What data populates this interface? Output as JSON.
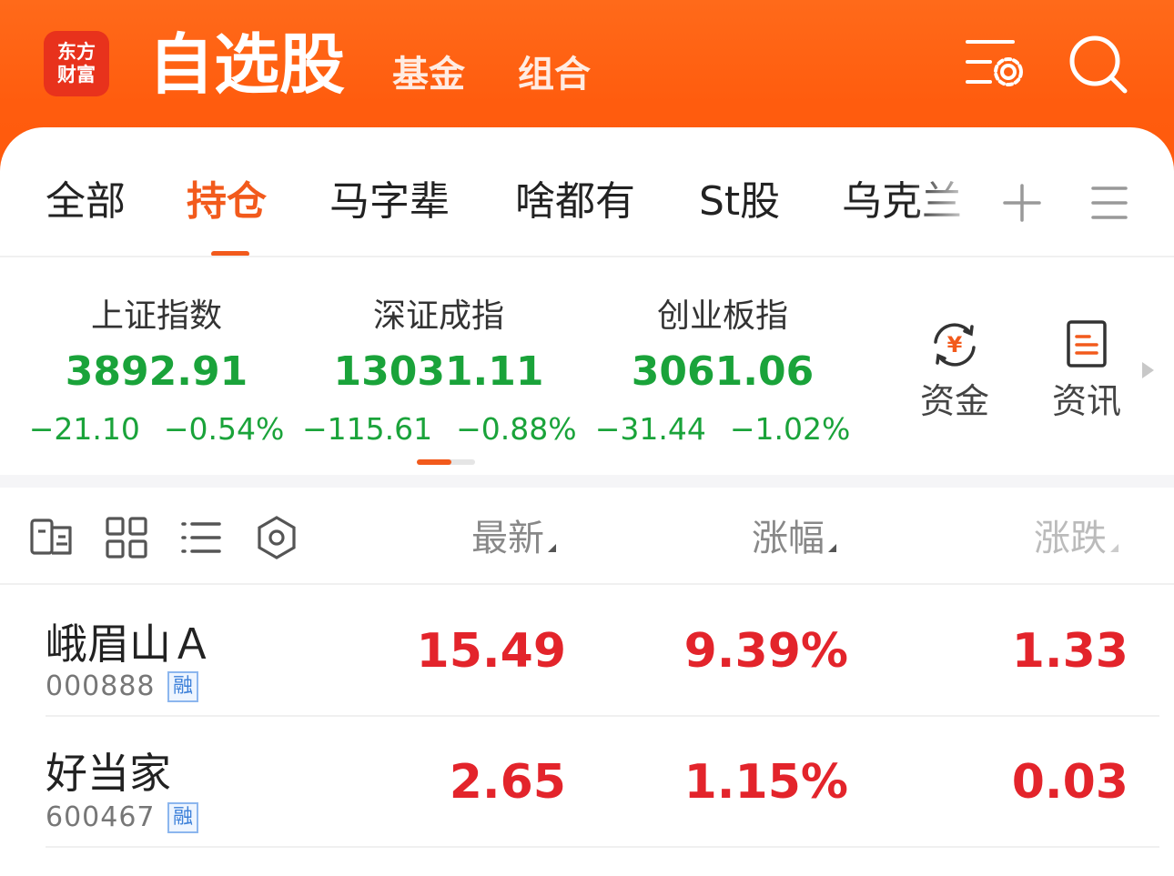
{
  "app": {
    "logo_line1": "东方",
    "logo_line2": "财富",
    "title": "自选股",
    "nav_fund": "基金",
    "nav_portfolio": "组合"
  },
  "group_tabs": [
    "全部",
    "持仓",
    "马字辈",
    "啥都有",
    "St股",
    "乌克兰"
  ],
  "active_tab_index": 1,
  "indices": [
    {
      "name": "上证指数",
      "value": "3892.91",
      "change": "−21.10",
      "change_pct": "−0.54%"
    },
    {
      "name": "深证成指",
      "value": "13031.11",
      "change": "−115.61",
      "change_pct": "−0.88%"
    },
    {
      "name": "创业板指",
      "value": "3061.06",
      "change": "−31.44",
      "change_pct": "−1.02%"
    }
  ],
  "quick_links": {
    "funds": "资金",
    "news": "资讯"
  },
  "table_header": {
    "latest": "最新",
    "change_pct": "涨幅",
    "change": "涨跌"
  },
  "stocks": [
    {
      "name": "峨眉山Ａ",
      "code": "000888",
      "badge": "融",
      "latest": "15.49",
      "change_pct": "9.39%",
      "change": "1.33"
    },
    {
      "name": "好当家",
      "code": "600467",
      "badge": "融",
      "latest": "2.65",
      "change_pct": "1.15%",
      "change": "0.03"
    }
  ],
  "colors": {
    "brand_orange": "#ff5c0e",
    "active_tab": "#f25a1c",
    "down_green": "#1aa33a",
    "up_red": "#e3242b"
  }
}
